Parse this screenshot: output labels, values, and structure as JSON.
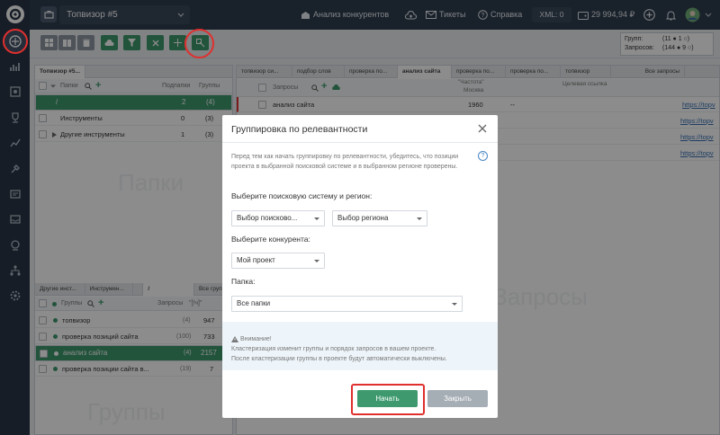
{
  "topbar": {
    "project_name": "Топвизор #5",
    "competitors": "Анализ конкурентов",
    "tickets": "Тикеты",
    "help": "Справка",
    "xml": "XML: 0",
    "balance": "29 994,94 ₽"
  },
  "stats": {
    "groups_label": "Групп:",
    "groups_value": "(11 ● 1 ○)",
    "queries_label": "Запросов:",
    "queries_value": "(144 ● 9 ○)"
  },
  "left": {
    "top_tab": "Топвизор #5...",
    "folders_header": "Папки",
    "subfolders_header": "Подпапки",
    "groups_header": "Группы",
    "folders": [
      {
        "name": "/",
        "sub": "2",
        "groups": "(4)"
      },
      {
        "name": "Инструменты",
        "sub": "0",
        "groups": "(3)"
      },
      {
        "name": "Другие инструменты",
        "sub": "1",
        "groups": "(3)"
      }
    ],
    "folders_watermark": "Папки",
    "bottom_tabs": [
      "Другие инст...",
      "Инструмен...",
      "/",
      "Все груп"
    ],
    "groups_col": "Группы",
    "queries_col": "Запросы",
    "freq_col": "\"[!ч]\"",
    "groups": [
      {
        "name": "топвизор",
        "count": "(4)",
        "freq": "947"
      },
      {
        "name": "проверка позиций сайта",
        "count": "(100)",
        "freq": "733"
      },
      {
        "name": "анализ сайта",
        "count": "(4)",
        "freq": "2157"
      },
      {
        "name": "проверка позиции сайта в...",
        "count": "(19)",
        "freq": "7"
      }
    ],
    "groups_watermark": "Группы"
  },
  "right": {
    "tabs": [
      "топвизор си...",
      "подбор слов",
      "проверка по...",
      "анализ сайта",
      "проверка по...",
      "проверка по...",
      "топвизор",
      "Все запросы"
    ],
    "col_queries": "Запросы",
    "col_freq": "\"Частота\"",
    "col_region": "Москва",
    "col_url": "Целевая ссылка",
    "rows": [
      {
        "q": "анализ сайта",
        "f": "1960",
        "u": "--",
        "link": "https://topv"
      },
      {
        "q": "",
        "f": "",
        "u": "",
        "link": "https://topv"
      },
      {
        "q": "",
        "f": "",
        "u": "",
        "link": "https://topv"
      },
      {
        "q": "",
        "f": "",
        "u": "",
        "link": "https://topv"
      }
    ],
    "watermark": "Запросы"
  },
  "modal": {
    "title": "Группировка по релевантности",
    "intro": "Перед тем как начать группировку по релевантности, убедитесь, что позиции проекта в выбранной поисковой системе и в выбранном регионе проверены.",
    "help_glyph": "?",
    "se_label": "Выберите поисковую систему и регион:",
    "se_select": "Выбор поисково...",
    "region_select": "Выбор региона",
    "competitor_label": "Выберите конкурента:",
    "competitor_select": "Мой проект",
    "folder_label": "Папка:",
    "folder_select": "Все папки",
    "warn_title": "Внимание!",
    "warn_line1": "Кластеризация изменит группы и порядок запросов в вашем проекте.",
    "warn_line2": "После кластеризации группы в проекте будут автоматически выключены.",
    "start_button": "Начать",
    "close_button": "Закрыть"
  },
  "colors": {
    "accent": "#3e9a6e",
    "sidebar": "#2a3646",
    "highlight": "#e0302e"
  }
}
